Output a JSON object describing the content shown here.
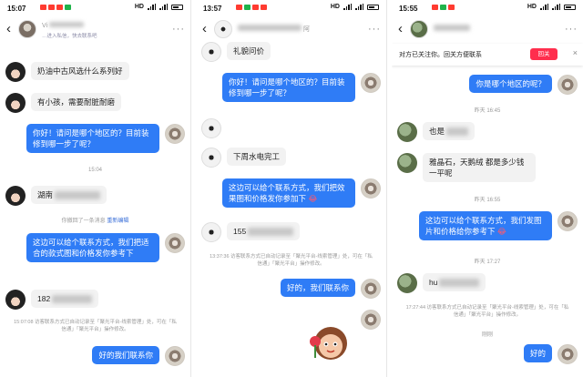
{
  "panels": [
    {
      "status": {
        "time": "15:07",
        "signal": "HD",
        "battery": ""
      },
      "nav": {
        "name": "Vi",
        "note": "…进入私信，快去联系吧"
      },
      "messages": [
        {
          "side": "left",
          "text": "奶油中古风选什么系列好"
        },
        {
          "side": "left",
          "text": "有小孩，需要耐脏耐磨"
        },
        {
          "side": "right",
          "text": "你好！请问是哪个地区的？目前装修到哪一步了呢？"
        },
        {
          "time": "15:04"
        },
        {
          "side": "left",
          "text": "湖南"
        },
        {
          "recall": "你撤回了一条消息",
          "recall_edit": "重新编辑"
        },
        {
          "side": "right",
          "text": "这边可以给个联系方式，我们把适合的款式图和价格发你参考下"
        },
        {
          "side": "left",
          "text": "182"
        },
        {
          "sys": "15:07:08 访客联系方式已自动记录至「聚光平台-线索管理」处，可在「私信通」「聚光平台」操作修改。"
        },
        {
          "side": "right",
          "text": "好的我们联系你"
        }
      ]
    },
    {
      "status": {
        "time": "13:57",
        "signal": "HD",
        "battery": ""
      },
      "nav": {
        "name": "阿",
        "note": ""
      },
      "messages": [
        {
          "side": "left",
          "text": "礼貌问价"
        },
        {
          "side": "right",
          "text": "你好！请问是哪个地区的？目前装修到哪一步了呢？"
        },
        {
          "side": "left",
          "text": "下周水电完工"
        },
        {
          "side": "right",
          "text": "这边可以给个联系方式，我们把效果图和价格发你参加下"
        },
        {
          "side": "left",
          "text": "155"
        },
        {
          "sys": "13:37:36 访客联系方式已自动记录至「聚光平台-线索管理」处，可在「私信通」「聚光平台」操作修改。"
        },
        {
          "side": "right",
          "text": "好的，我们联系你"
        }
      ]
    },
    {
      "status": {
        "time": "15:55",
        "signal": "HD",
        "battery": ""
      },
      "banner": {
        "text": "对方已关注你。回关方便联系",
        "button": "回关",
        "close": "×"
      },
      "messages": [
        {
          "side": "right",
          "text": "你是哪个地区的呢？"
        },
        {
          "time": "昨天 16:45"
        },
        {
          "side": "left",
          "text": "也是"
        },
        {
          "side": "left",
          "text": "雅晶石，天鹅绒 都是多少钱一平呢"
        },
        {
          "time": "昨天 16:55"
        },
        {
          "side": "right",
          "text": "这边可以给个联系方式，我们发图片和价格给你参考下"
        },
        {
          "time": "昨天 17:27"
        },
        {
          "side": "left",
          "text": "hu"
        },
        {
          "sys": "17:27:44 访客联系方式已自动记录至「聚光平台-线索管理」处，可在「私信通」「聚光平台」操作修改。"
        },
        {
          "time": "刚刚"
        },
        {
          "side": "right",
          "text": "好的"
        }
      ]
    }
  ]
}
